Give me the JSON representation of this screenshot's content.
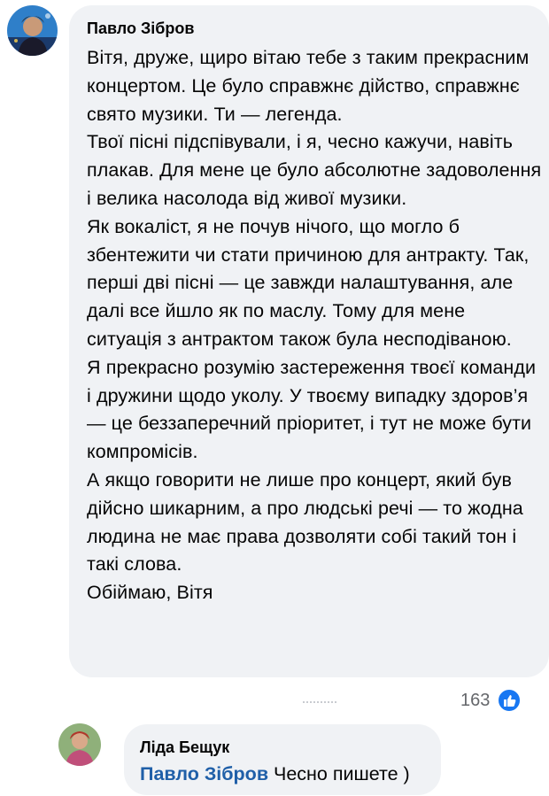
{
  "comment": {
    "author": "Павло Зібров",
    "paragraphs": [
      "Вітя, друже, щиро вітаю тебе з таким прекрасним концертом. Це було справжнє дійство, справжнє свято музики. Ти — легенда.",
      "Твої пісні підспівували, і я, чесно кажучи, навіть плакав. Для мене це було абсолютне задоволення і велика насолода від живої музики.",
      "Як вокаліст, я не почув нічого, що могло б збентежити чи стати причиною для антракту. Так, перші дві пісні — це завжди налаштування, але далі все йшло як по маслу. Тому для мене ситуація з антрактом також була несподіваною.",
      "Я прекрасно розумію застереження твоєї команди і дружини щодо уколу. У твоєму випадку здоров’я — це беззаперечний пріоритет, і тут не може бути компромісів.",
      "А якщо говорити не лише про концерт, який був дійсно шикарним, а про людські речі — то жодна людина не має права дозволяти собі такий тон і такі слова.",
      "Обіймаю, Вітя"
    ],
    "reaction_count": "163",
    "reaction_icon": "like-icon"
  },
  "reply": {
    "author": "Ліда Бещук",
    "mention": "Павло Зібров",
    "text": "Чесно пишете )"
  },
  "colors": {
    "bubble": "#f0f2f5",
    "mention": "#1f5fa8",
    "like": "#1877f2"
  }
}
